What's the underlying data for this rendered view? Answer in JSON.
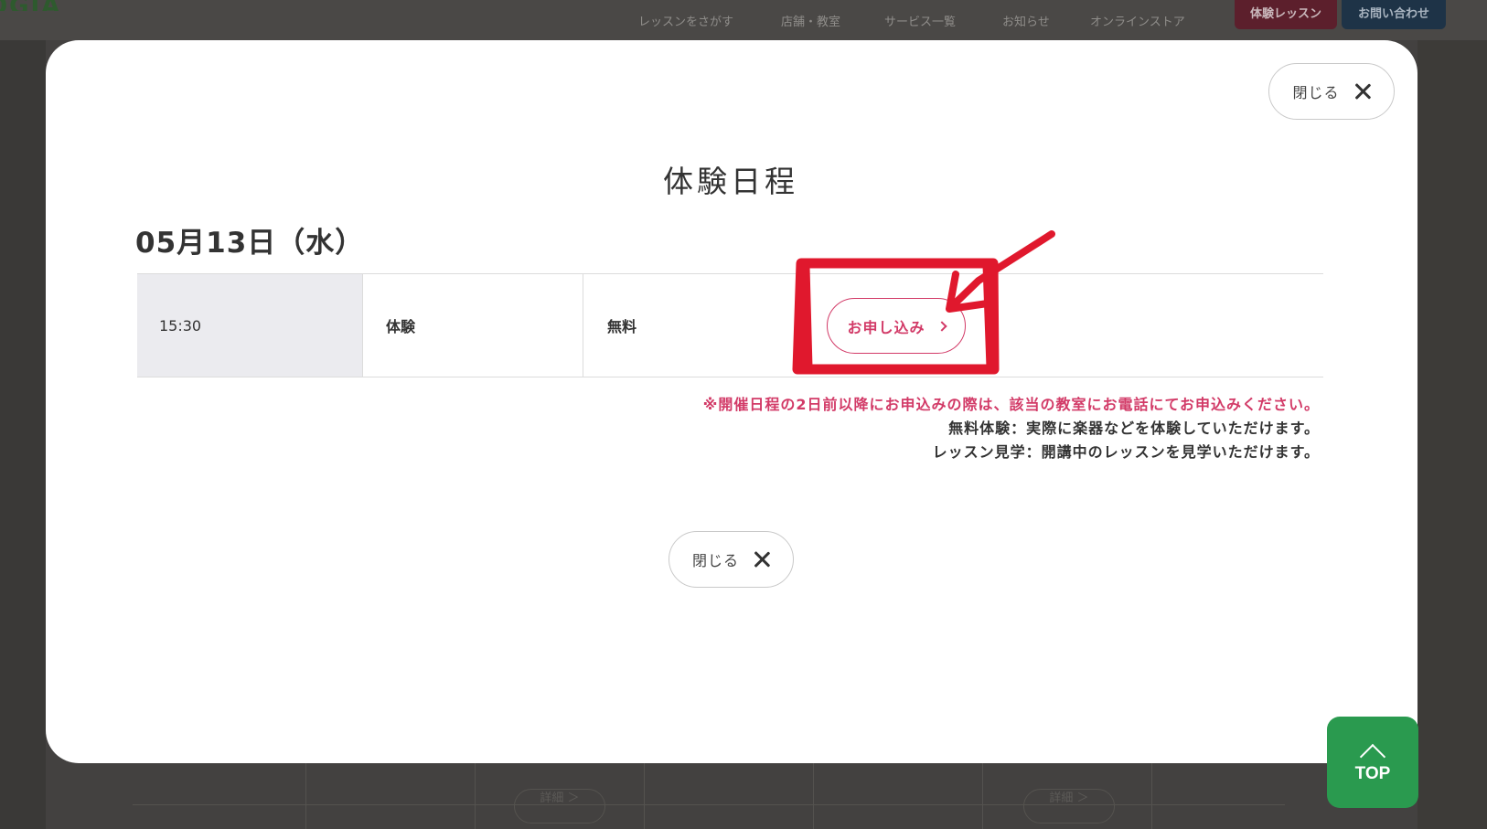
{
  "background": {
    "logo_text": "OGIA",
    "nav": [
      {
        "label": "レッスンをさがす"
      },
      {
        "label": "店舗・教室"
      },
      {
        "label": "サービス一覧"
      },
      {
        "label": "お知らせ"
      },
      {
        "label": "オンラインストア"
      }
    ],
    "trial_button": "体験レッスン",
    "contact_button": "お問い合わせ",
    "detail_pills": [
      "詳細 ＞",
      "詳細 ＞"
    ]
  },
  "modal": {
    "close_top_label": "閉じる",
    "title": "体験日程",
    "date_heading": "05月13日（水）",
    "schedule": {
      "time": "15:30",
      "type": "体験",
      "price": "無料",
      "apply_label": "お申し込み"
    },
    "notes": {
      "warning": "※開催日程の2日前以降にお申込みの際は、該当の教室にお電話にてお申込みください。",
      "free_trial": "無料体験：実際に楽器などを体験していただけます。",
      "lesson_visit": "レッスン見学：開講中のレッスンを見学いただけます。"
    },
    "close_bottom_label": "閉じる"
  },
  "top_button": {
    "label": "TOP"
  },
  "colors": {
    "accent": "#d23a67",
    "annotation_red": "#e0182d",
    "top_green": "#2a9a4f",
    "time_cell_bg": "#ebebef"
  }
}
